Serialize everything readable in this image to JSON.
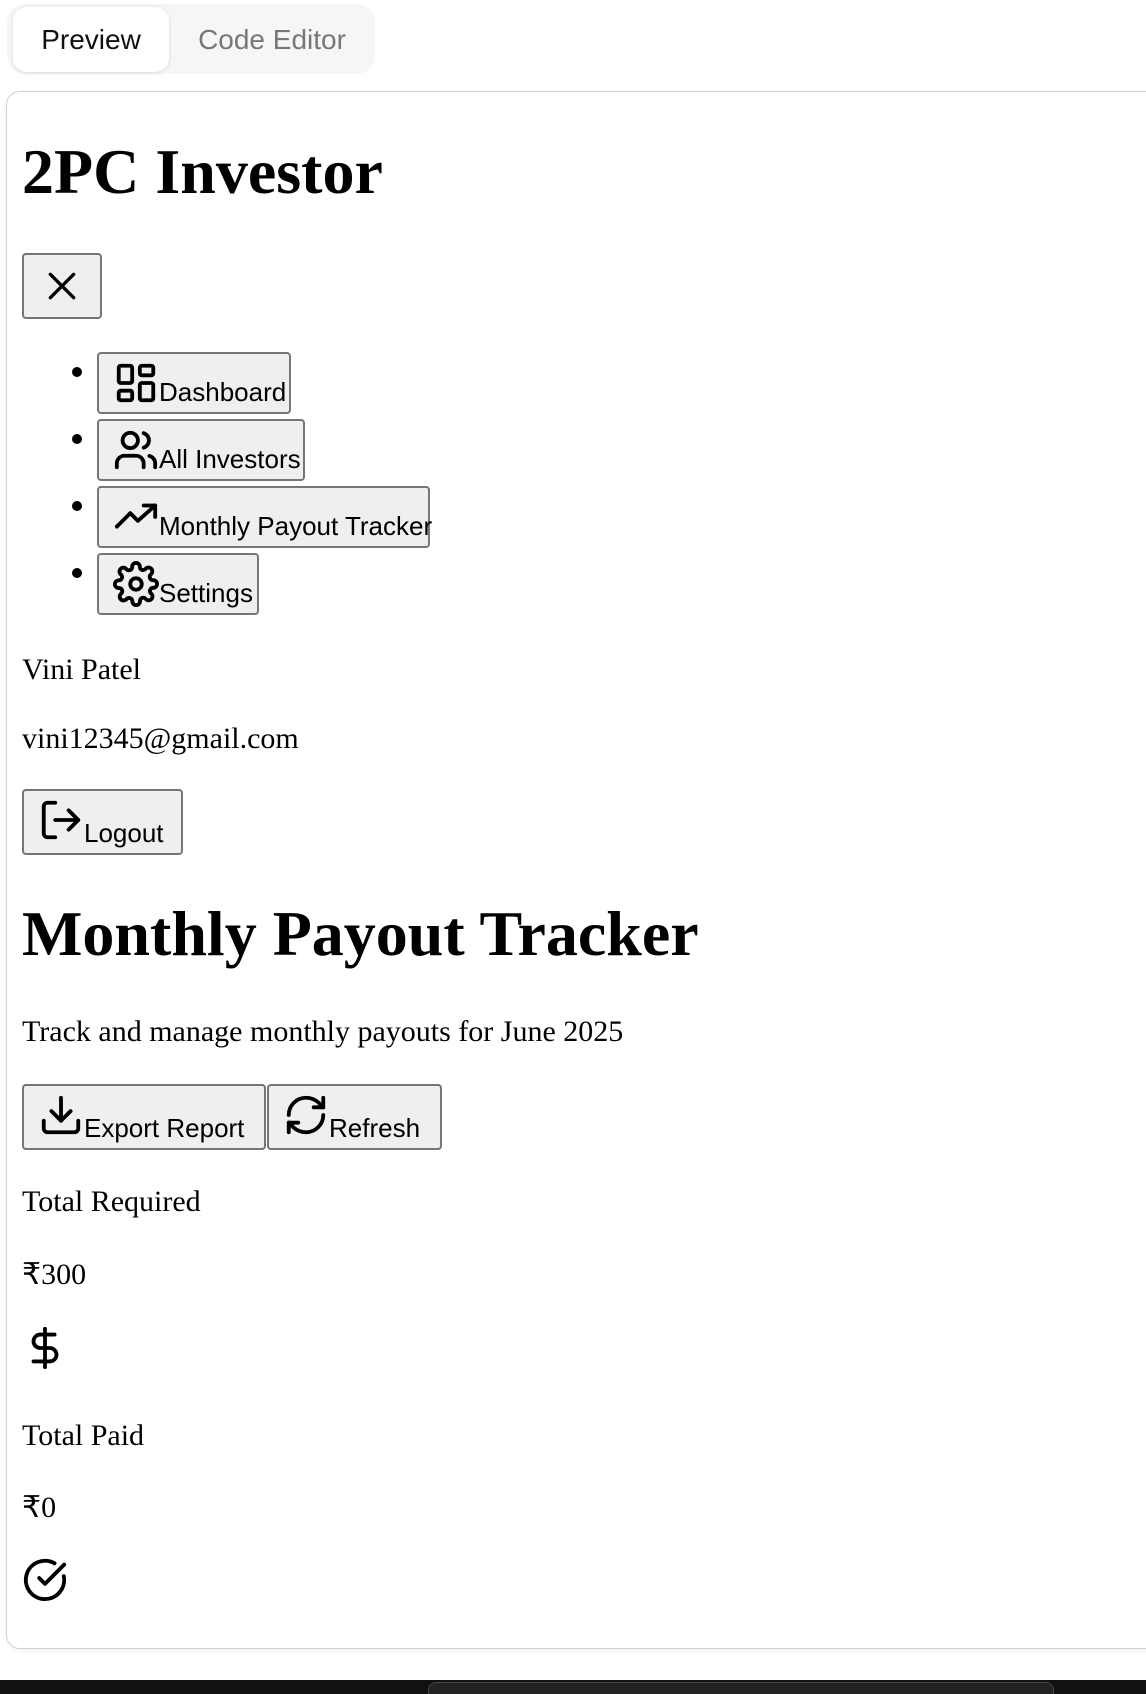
{
  "tabs": {
    "preview_label": "Preview",
    "code_editor_label": "Code Editor"
  },
  "app": {
    "title": "2PC Investor"
  },
  "nav": {
    "items": [
      {
        "label": "Dashboard",
        "icon": "dashboard-icon"
      },
      {
        "label": "All Investors",
        "icon": "users-icon"
      },
      {
        "label": "Monthly Payout Tracker",
        "icon": "trending-up-icon"
      },
      {
        "label": "Settings",
        "icon": "gear-icon"
      }
    ]
  },
  "user": {
    "name": "Vini Patel",
    "email": "vini12345@gmail.com",
    "logout_label": "Logout"
  },
  "page": {
    "title": "Monthly Payout Tracker",
    "subtitle": "Track and manage monthly payouts for June 2025",
    "export_label": "Export Report",
    "refresh_label": "Refresh"
  },
  "stats": {
    "total_required_label": "Total Required",
    "total_required_value": "₹300",
    "total_required_icon": "dollar-icon",
    "total_paid_label": "Total Paid",
    "total_paid_value": "₹0",
    "total_paid_icon": "check-circle-icon"
  }
}
